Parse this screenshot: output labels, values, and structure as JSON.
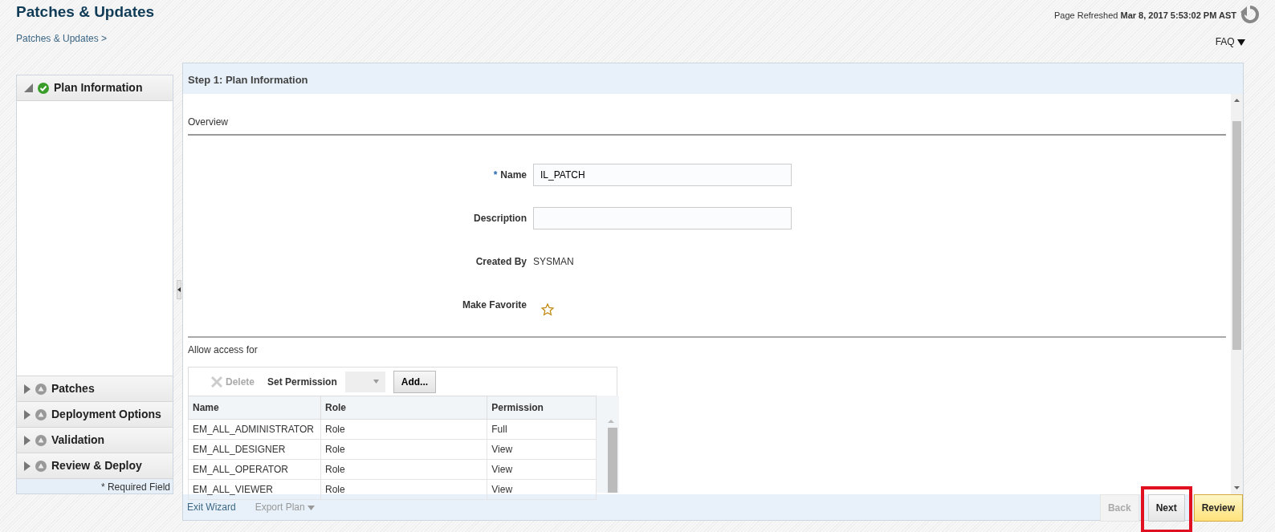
{
  "page": {
    "title": "Patches & Updates",
    "refreshed_label": "Page Refreshed",
    "refreshed_time": "Mar 8, 2017 5:53:02 PM AST",
    "breadcrumb": "Patches & Updates >",
    "faq": "FAQ"
  },
  "steps": [
    {
      "label": "Plan Information",
      "expanded": true,
      "done": true
    },
    {
      "label": "Patches",
      "expanded": false,
      "done": false
    },
    {
      "label": "Deployment Options",
      "expanded": false,
      "done": false
    },
    {
      "label": "Validation",
      "expanded": false,
      "done": false
    },
    {
      "label": "Review & Deploy",
      "expanded": false,
      "done": false
    }
  ],
  "required_note": "* Required Field",
  "panel": {
    "title": "Step 1: Plan Information",
    "overview": "Overview",
    "required_mark": "*",
    "fields": [
      {
        "kind": "input",
        "label": "Name",
        "required": true,
        "value": "IL_PATCH"
      },
      {
        "kind": "input",
        "label": "Description",
        "required": false
      },
      {
        "kind": "text",
        "label": "Created By",
        "required": false,
        "value": "SYSMAN"
      },
      {
        "kind": "star",
        "label": "Make Favorite",
        "required": false,
        "favorite": false
      }
    ],
    "access": {
      "heading": "Allow access for",
      "delete": "Delete",
      "delete_disabled": true,
      "set_permission": "Set Permission",
      "add": "Add...",
      "columns": [
        "Name",
        "Role",
        "Permission"
      ],
      "rows": [
        [
          "EM_ALL_ADMINISTRATOR",
          "Role",
          "Full"
        ],
        [
          "EM_ALL_DESIGNER",
          "Role",
          "View"
        ],
        [
          "EM_ALL_OPERATOR",
          "Role",
          "View"
        ],
        [
          "EM_ALL_VIEWER",
          "Role",
          "View"
        ]
      ]
    }
  },
  "footer": {
    "links": [
      {
        "label": "Exit Wizard",
        "disabled": false
      },
      {
        "label": "Export Plan",
        "disabled": true,
        "menu": true
      }
    ],
    "buttons": [
      {
        "label": "Back",
        "kind": "plain",
        "disabled": true,
        "highlighted": false
      },
      {
        "label": "Next",
        "kind": "plain",
        "disabled": false,
        "highlighted": true
      },
      {
        "label": "Review",
        "kind": "accent",
        "disabled": false,
        "highlighted": false
      }
    ]
  }
}
